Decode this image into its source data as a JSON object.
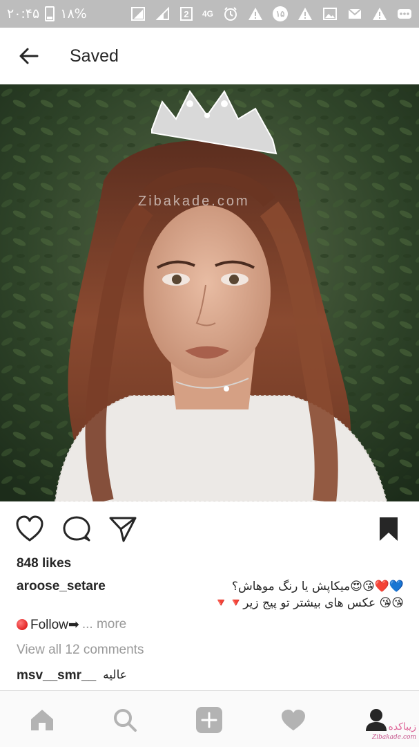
{
  "status_bar": {
    "time": "۲۰:۴۵",
    "battery": "۱۸%",
    "sim_number": "2",
    "network": "4G",
    "badge_number": "۱۵"
  },
  "header": {
    "title": "Saved"
  },
  "photo": {
    "watermark": "Zibakade.com"
  },
  "post": {
    "likes": "848 likes",
    "username": "aroose_setare",
    "caption_line1": "💙❤️😘😍میکاپش یا رنگ موهاش؟",
    "caption_line2": "😘😘 عکس های بیشتر تو پیج زیر🔻🔻",
    "follow_text": "Follow➡",
    "more_text": "... more",
    "view_comments": "View all 12 comments",
    "comment": {
      "user": "msv__smr__",
      "text": "عالیه"
    }
  },
  "bottom_nav": {
    "watermark_text": "زیباکده",
    "watermark_sub": "Zibakade.com"
  },
  "colors": {
    "status_bar_bg": "#bdbdbd",
    "text_primary": "#262626",
    "text_muted": "#999999",
    "nav_icon": "#b3b3b3"
  }
}
